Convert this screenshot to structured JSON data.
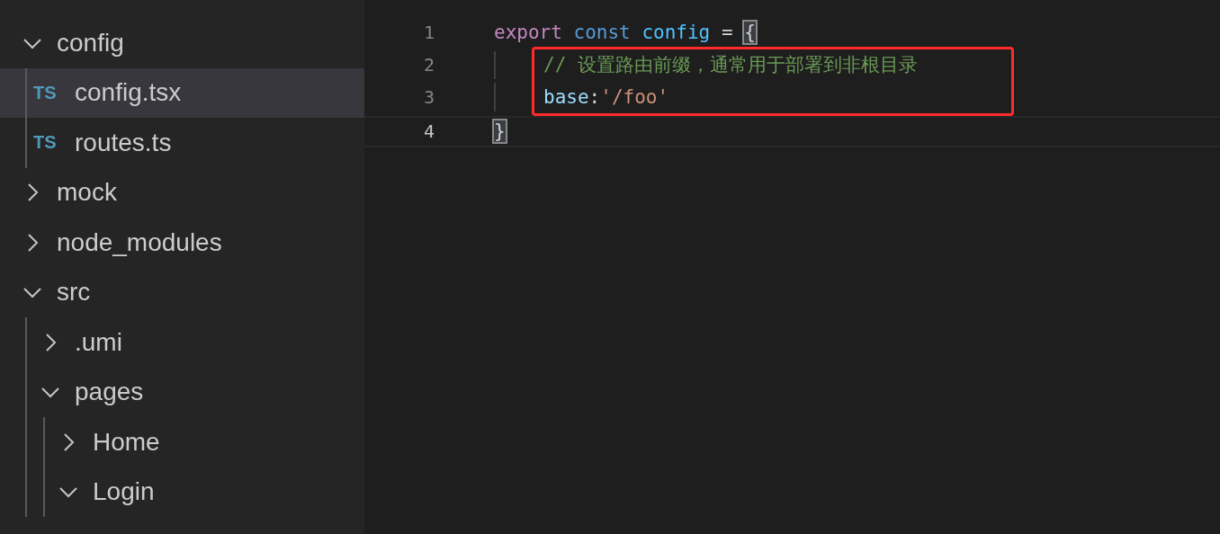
{
  "explorer": {
    "items": [
      {
        "kind": "folder",
        "label": "config",
        "expanded": true,
        "selected": false,
        "children": [
          {
            "kind": "file",
            "icon": "TS",
            "label": "config.tsx",
            "selected": true
          },
          {
            "kind": "file",
            "icon": "TS",
            "label": "routes.ts",
            "selected": false
          }
        ]
      },
      {
        "kind": "folder",
        "label": "mock",
        "expanded": false,
        "selected": false
      },
      {
        "kind": "folder",
        "label": "node_modules",
        "expanded": false,
        "selected": false
      },
      {
        "kind": "folder",
        "label": "src",
        "expanded": true,
        "selected": false,
        "children": [
          {
            "kind": "folder",
            "label": ".umi",
            "expanded": false,
            "selected": false
          },
          {
            "kind": "folder",
            "label": "pages",
            "expanded": true,
            "selected": false,
            "children": [
              {
                "kind": "folder",
                "label": "Home",
                "expanded": false,
                "selected": false
              },
              {
                "kind": "folder",
                "label": "Login",
                "expanded": true,
                "selected": false
              }
            ]
          }
        ]
      }
    ]
  },
  "editor": {
    "lines": [
      {
        "number": "1",
        "active": false,
        "indented": false,
        "highlighted": false,
        "tokens": [
          {
            "kind": "keyword",
            "text": "export "
          },
          {
            "kind": "storage",
            "text": "const "
          },
          {
            "kind": "constant",
            "text": "config"
          },
          {
            "kind": "plain",
            "text": " = "
          },
          {
            "kind": "bracket",
            "text": "{"
          }
        ]
      },
      {
        "number": "2",
        "active": false,
        "indented": true,
        "highlighted": true,
        "tokens": [
          {
            "kind": "comment",
            "text": "// 设置路由前缀，通常用于部署到非根目录"
          }
        ]
      },
      {
        "number": "3",
        "active": false,
        "indented": true,
        "highlighted": true,
        "tokens": [
          {
            "kind": "property",
            "text": "base"
          },
          {
            "kind": "plain",
            "text": ":"
          },
          {
            "kind": "string",
            "text": "'/foo'"
          }
        ]
      },
      {
        "number": "4",
        "active": true,
        "indented": false,
        "highlighted": false,
        "tokens": [
          {
            "kind": "bracket",
            "text": "}"
          }
        ]
      }
    ]
  }
}
